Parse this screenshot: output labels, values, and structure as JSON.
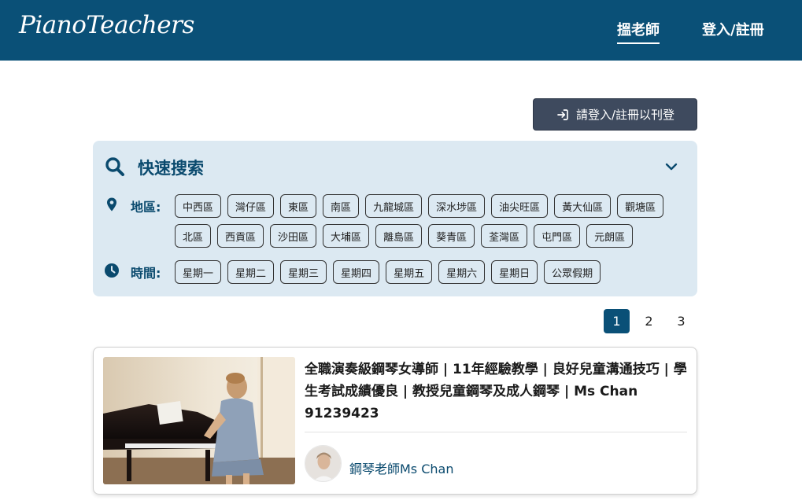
{
  "header": {
    "logo": "PianoTeachers",
    "nav": {
      "find_teacher": "搵老師",
      "login": "登入/註冊"
    }
  },
  "post_button": {
    "label": "請登入/註冊以刊登",
    "icon": "login-arrow-icon"
  },
  "search": {
    "title": "快速搜索",
    "region_label": "地區:",
    "regions": [
      "中西區",
      "灣仔區",
      "東區",
      "南區",
      "九龍城區",
      "深水埗區",
      "油尖旺區",
      "黃大仙區",
      "觀塘區",
      "北區",
      "西貢區",
      "沙田區",
      "大埔區",
      "離島區",
      "葵青區",
      "荃灣區",
      "屯門區",
      "元朗區"
    ],
    "time_label": "時間:",
    "times": [
      "星期一",
      "星期二",
      "星期三",
      "星期四",
      "星期五",
      "星期六",
      "星期日",
      "公眾假期"
    ]
  },
  "pagination": {
    "pages": [
      "1",
      "2",
      "3"
    ],
    "current": "1"
  },
  "listing": {
    "title": "全職演奏級鋼琴女導師 | 11年經驗教學 | 良好兒童溝通技巧 | 學生考試成績優良 | 教授兒童鋼琴及成人鋼琴 | Ms Chan 91239423",
    "teacher_name": "鋼琴老師Ms Chan"
  },
  "colors": {
    "brand": "#0a5077",
    "panel_bg": "#dce9f2",
    "button_dark": "#3e4a5e"
  }
}
